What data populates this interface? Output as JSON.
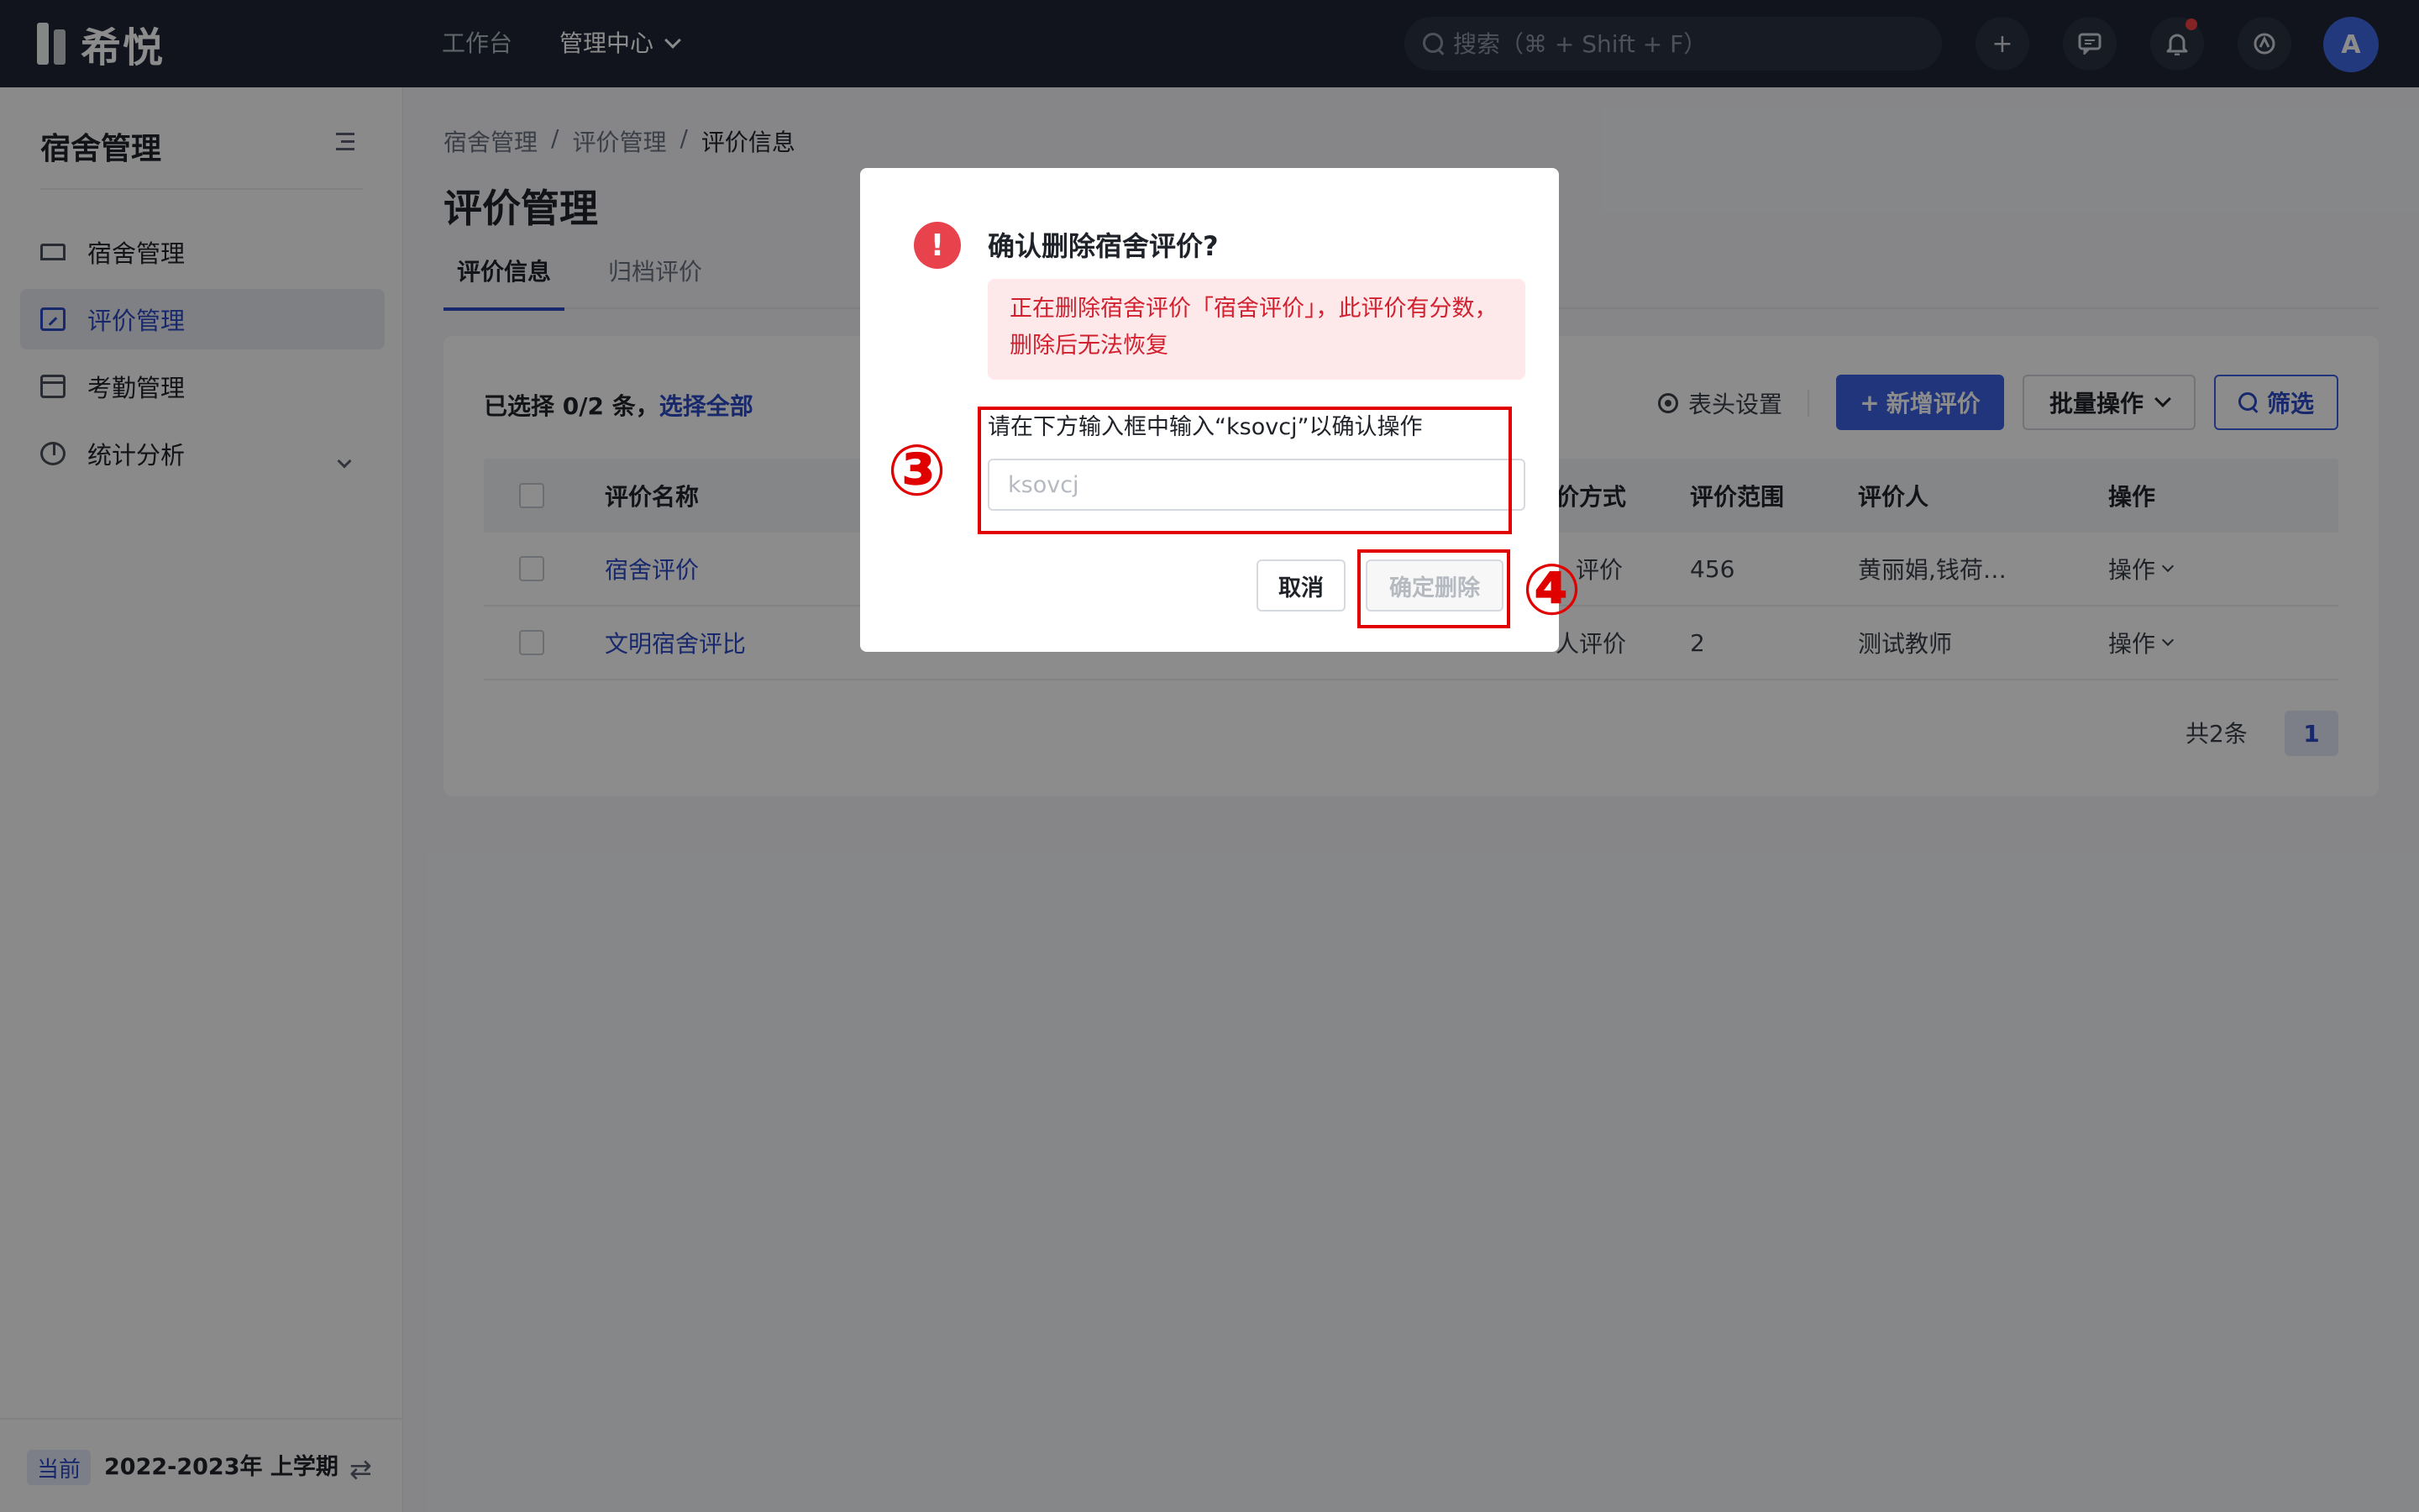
{
  "topbar": {
    "logo_text": "希悦",
    "nav": [
      {
        "label": "工作台"
      },
      {
        "label": "管理中心"
      }
    ],
    "search_placeholder": "搜索（⌘ + Shift + F）",
    "avatar_letter": "A"
  },
  "sidebar": {
    "title": "宿舍管理",
    "items": [
      {
        "label": "宿舍管理",
        "icon": "bed-icon"
      },
      {
        "label": "评价管理",
        "icon": "chart-doc-icon"
      },
      {
        "label": "考勤管理",
        "icon": "calendar-icon"
      },
      {
        "label": "统计分析",
        "icon": "pie-chart-icon"
      }
    ],
    "footer": {
      "tag": "当前",
      "term": "2022-2023年 上学期"
    }
  },
  "main": {
    "breadcrumb": [
      "宿舍管理",
      "/",
      "评价管理",
      "/",
      "评价信息"
    ],
    "title": "评价管理",
    "tabs": [
      {
        "label": "评价信息"
      },
      {
        "label": "归档评价"
      }
    ],
    "selection": {
      "text": "已选择 0/2 条，",
      "select_all": "选择全部"
    },
    "toolbar": {
      "column_settings": "表头设置",
      "add_label": "新增评价",
      "batch_label": "批量操作",
      "filter_label": "筛选"
    },
    "table": {
      "headers": {
        "name": "评价名称",
        "method": "价方式",
        "scope": "评价范围",
        "evaluator": "评价人",
        "action": "操作"
      },
      "rows": [
        {
          "name": "宿舍评价",
          "method": "评价",
          "scope": "456",
          "evaluator": "黄丽娟,钱荷…",
          "action": "操作"
        },
        {
          "name": "文明宿舍评比",
          "method": "人评价",
          "scope": "2",
          "evaluator": "测试教师",
          "action": "操作"
        }
      ]
    },
    "pager": {
      "total": "共2条",
      "page": "1"
    }
  },
  "modal": {
    "icon": "exclamation-icon",
    "title": "确认删除宿舍评价?",
    "alert": "正在删除宿舍评价「宿舍评价」，此评价有分数，删除后无法恢复",
    "confirm_label": "请在下方输入框中输入“ksovcj”以确认操作",
    "input_placeholder": "ksovcj",
    "cancel_label": "取消",
    "confirm_button": "确定删除"
  },
  "annotations": [
    {
      "number": "③"
    },
    {
      "number": "④"
    }
  ],
  "colors": {
    "accent": "#3b62e0",
    "danger": "#e8424d",
    "annotation": "#e00000",
    "topbar": "#1f2533"
  }
}
